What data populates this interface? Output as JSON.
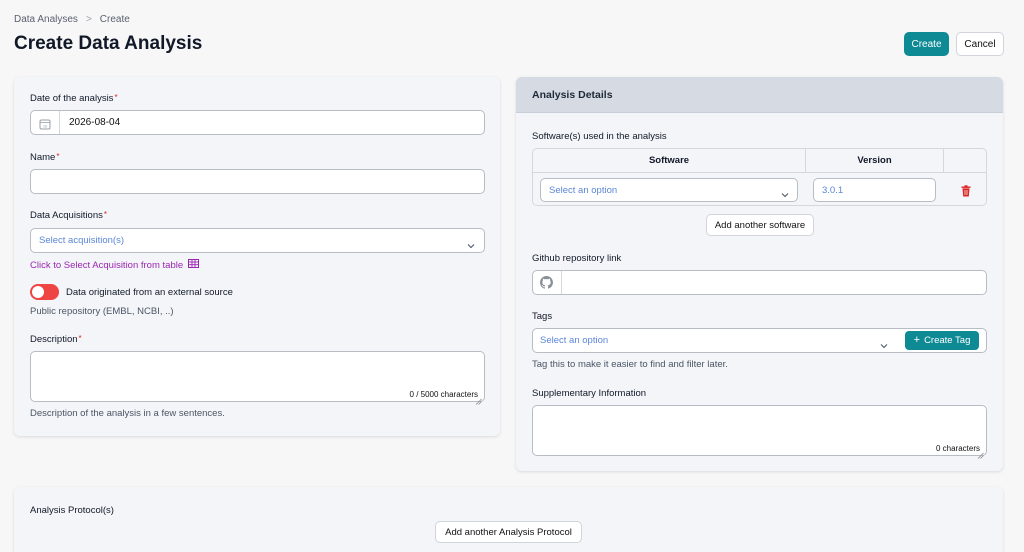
{
  "breadcrumb": {
    "root": "Data Analyses",
    "separator": ">",
    "current": "Create"
  },
  "page": {
    "title": "Create Data Analysis"
  },
  "actions": {
    "create": "Create",
    "cancel": "Cancel"
  },
  "left": {
    "date": {
      "label": "Date of the analysis",
      "value": "2026-08-04",
      "icon": "calendar-icon"
    },
    "name": {
      "label": "Name",
      "value": ""
    },
    "acquisitions": {
      "label": "Data Acquisitions",
      "placeholder": "Select acquisition(s)",
      "table_link": "Click to Select Acquisition from table"
    },
    "external": {
      "label": "Data originated from an external source",
      "help": "Public repository (EMBL, NCBI, ..)",
      "enabled": true
    },
    "description": {
      "label": "Description",
      "counter": "0 / 5000 characters",
      "help": "Description of the analysis in a few sentences."
    }
  },
  "right": {
    "title": "Analysis Details",
    "software": {
      "label": "Software(s) used in the analysis",
      "columns": [
        "Software",
        "Version"
      ],
      "row": {
        "software_placeholder": "Select an option",
        "version": "3.0.1"
      },
      "add_button": "Add another software"
    },
    "github": {
      "label": "Github repository link",
      "value": ""
    },
    "tags": {
      "label": "Tags",
      "placeholder": "Select an option",
      "create_button": "Create Tag",
      "help": "Tag this to make it easier to find and filter later."
    },
    "supplementary": {
      "label": "Supplementary Information",
      "counter": "0 characters"
    }
  },
  "bottom": {
    "label": "Analysis Protocol(s)",
    "add_button": "Add another Analysis Protocol"
  },
  "colors": {
    "accent": "#0e8a94",
    "required": "#dc2626",
    "link": "#9b27b0",
    "placeholder": "#5b86d6",
    "toggle": "#ef4444",
    "delete": "#dc2626"
  }
}
